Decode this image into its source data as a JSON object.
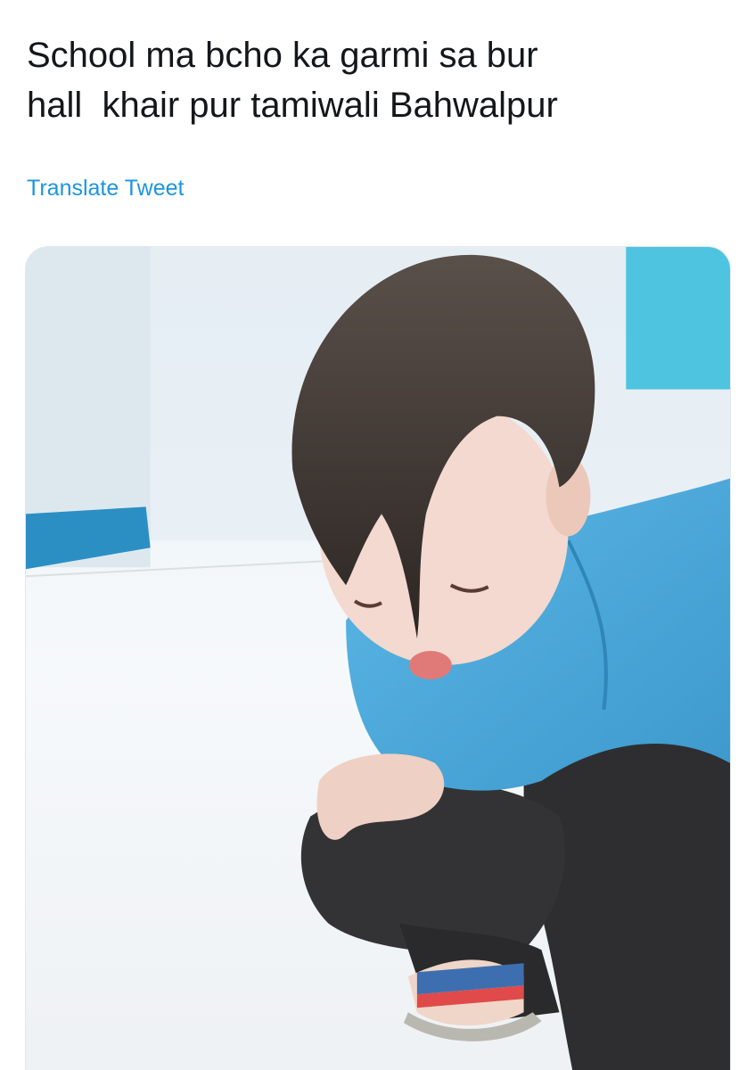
{
  "tweet": {
    "text": "School ma bcho ka garmi sa bur\nhall  khair pur tamiwali Bahwalpur",
    "translate_label": "Translate Tweet"
  },
  "media": {
    "type": "photo",
    "colors": {
      "background": "#eef3f7",
      "shirt": "#4ba9dc",
      "trousers": "#2e2e30",
      "hair": "#3a3330",
      "skin": "#f3d9cf",
      "wall_accent": "#2b8fc4"
    }
  },
  "colors": {
    "text": "#14171a",
    "link": "#1b95e0",
    "border": "#e1e8ed"
  }
}
